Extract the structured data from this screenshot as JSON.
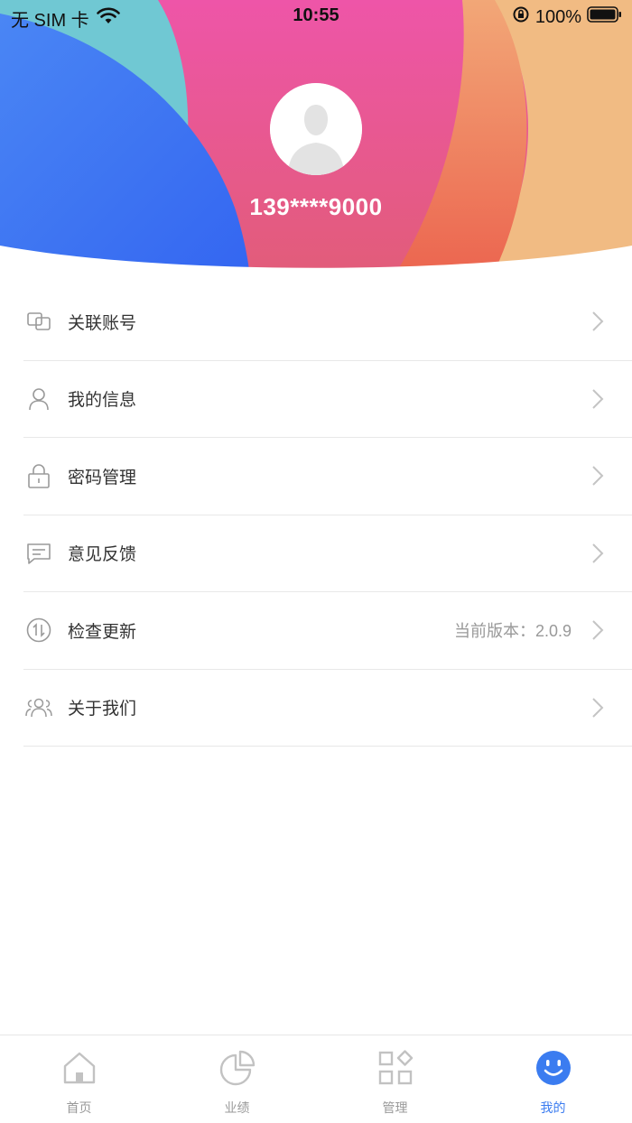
{
  "status_bar": {
    "carrier": "无 SIM 卡",
    "time": "10:55",
    "battery": "100%"
  },
  "profile": {
    "phone": "139****9000"
  },
  "menu": [
    {
      "label": "关联账号",
      "icon": "link-accounts-icon"
    },
    {
      "label": "我的信息",
      "icon": "user-icon"
    },
    {
      "label": "密码管理",
      "icon": "lock-icon"
    },
    {
      "label": "意见反馈",
      "icon": "message-icon"
    },
    {
      "label": "检查更新",
      "icon": "update-icon",
      "extra": "当前版本：2.0.9"
    },
    {
      "label": "关于我们",
      "icon": "group-icon"
    }
  ],
  "tabbar": [
    {
      "label": "首页",
      "icon": "home-icon",
      "active": false
    },
    {
      "label": "业绩",
      "icon": "pie-chart-icon",
      "active": false
    },
    {
      "label": "管理",
      "icon": "grid-icon",
      "active": false
    },
    {
      "label": "我的",
      "icon": "smiley-icon",
      "active": true
    }
  ],
  "colors": {
    "accent": "#3b7cf0",
    "header_blue": "#3d6ff2",
    "header_teal": "#6ec9d2",
    "header_pink": "#e74f9a",
    "header_orange": "#ee6e52",
    "header_peach": "#f1bd83"
  }
}
